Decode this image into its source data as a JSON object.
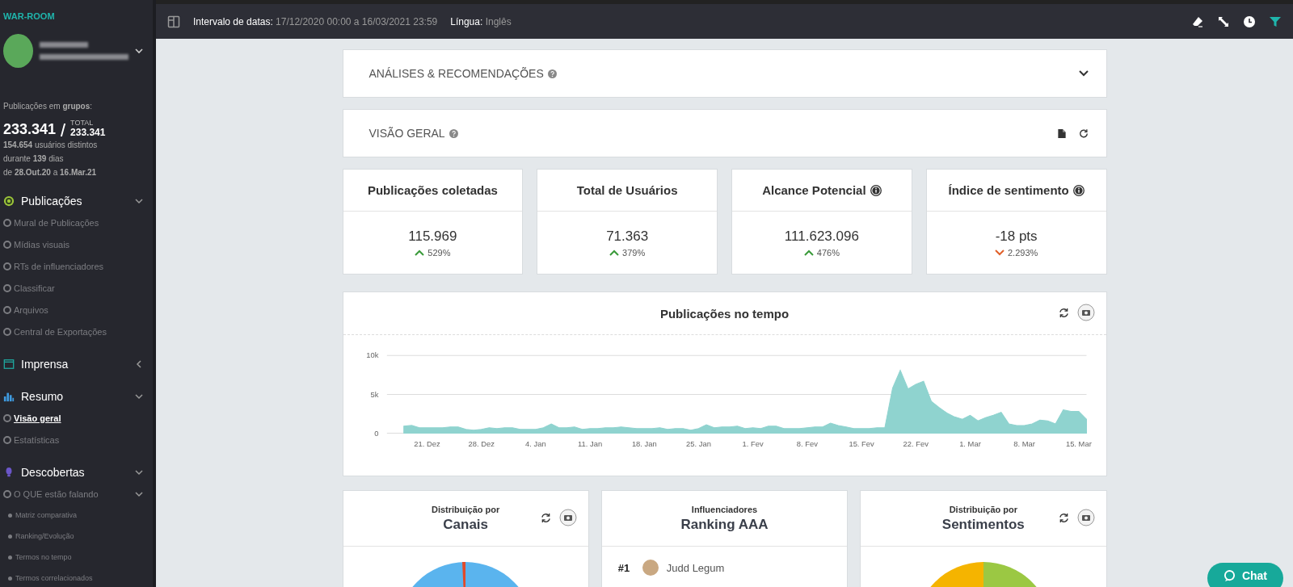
{
  "sidebar": {
    "brand": "WAR-ROOM",
    "stats": {
      "heading": "Publicações em **grupos**:",
      "count": "233.341",
      "total_label": "TOTAL",
      "total": "233.341",
      "lines": [
        "**154.654** usuários distintos",
        "durante **139** dias",
        "de **28.Out.20** a **16.Mar.21**"
      ]
    },
    "sections": [
      {
        "label": "Publicações",
        "kind": "target",
        "expanded": true,
        "items": [
          {
            "label": "Mural de Publicações",
            "selected": false
          },
          {
            "label": "Mídias visuais",
            "selected": false
          },
          {
            "label": "RTs de influenciadores",
            "selected": false
          },
          {
            "label": "Classificar",
            "selected": false
          },
          {
            "label": "Arquivos",
            "selected": false
          },
          {
            "label": "Central de Exportações",
            "selected": false
          }
        ]
      },
      {
        "label": "Imprensa",
        "kind": "newspaper",
        "expanded": false
      },
      {
        "label": "Resumo",
        "kind": "bars",
        "expanded": true,
        "items": [
          {
            "label": "Visão geral",
            "selected": true
          },
          {
            "label": "Estatísticas",
            "selected": false
          }
        ]
      },
      {
        "label": "Descobertas",
        "kind": "bulb",
        "expanded": true,
        "items": [
          {
            "label": "O QUE estão falando",
            "selected": false,
            "expanded": true,
            "children": [
              {
                "label": "Matriz comparativa"
              },
              {
                "label": "Ranking/Evolução"
              },
              {
                "label": "Termos no tempo"
              },
              {
                "label": "Termos correlacionados"
              }
            ]
          }
        ]
      }
    ]
  },
  "topbar": {
    "filters": [
      {
        "label": "Intervalo de datas:",
        "value": "17/12/2020 00:00 a 16/03/2021 23:59"
      },
      {
        "label": "Língua:",
        "value": "Inglês"
      }
    ],
    "filter_active": true
  },
  "panels": [
    {
      "kind": "collapsible",
      "title": "ANÁLISES & RECOMENDAÇÕES",
      "help": true
    },
    {
      "kind": "toolbar",
      "title": "VISÃO GERAL",
      "help": true
    }
  ],
  "kpis": [
    {
      "title": "Publicações coletadas",
      "info": false,
      "value": "115.969",
      "change": "529%",
      "up": true
    },
    {
      "title": "Total de Usuários",
      "info": false,
      "value": "71.363",
      "change": "379%",
      "up": true
    },
    {
      "title": "Alcance Potencial",
      "info": true,
      "value": "111.623.096",
      "change": "476%",
      "up": true
    },
    {
      "title": "Índice de sentimento",
      "info": true,
      "value": "-18 pts",
      "change": "2.293%",
      "up": false
    }
  ],
  "timeline": {
    "title": "Publicações no tempo",
    "chart_data": {
      "type": "area",
      "categories": [
        null,
        null,
        null,
        "21. Dez",
        null,
        null,
        null,
        null,
        null,
        null,
        "28. Dez",
        null,
        null,
        null,
        null,
        null,
        null,
        "4. Jan",
        null,
        null,
        null,
        null,
        null,
        null,
        "11. Jan",
        null,
        null,
        null,
        null,
        null,
        null,
        "18. Jan",
        null,
        null,
        null,
        null,
        null,
        null,
        "25. Jan",
        null,
        null,
        null,
        null,
        null,
        null,
        "1. Fev",
        null,
        null,
        null,
        null,
        null,
        null,
        "8. Fev",
        null,
        null,
        null,
        null,
        null,
        null,
        "15. Fev",
        null,
        null,
        null,
        null,
        null,
        null,
        "22. Fev",
        null,
        null,
        null,
        null,
        null,
        null,
        "1. Mar",
        null,
        null,
        null,
        null,
        null,
        null,
        "8. Mar",
        null,
        null,
        null,
        null,
        null,
        null,
        "15. Mar",
        null
      ],
      "series": [
        {
          "color": "#8fd3cf",
          "values": [
            900,
            1000,
            700,
            700,
            700,
            700,
            800,
            800,
            500,
            400,
            500,
            700,
            600,
            700,
            700,
            500,
            500,
            500,
            700,
            1200,
            700,
            700,
            800,
            500,
            600,
            600,
            700,
            700,
            800,
            700,
            600,
            600,
            600,
            700,
            500,
            600,
            600,
            400,
            600,
            1100,
            700,
            800,
            800,
            900,
            600,
            700,
            600,
            900,
            900,
            600,
            600,
            600,
            700,
            800,
            800,
            1300,
            1000,
            800,
            600,
            600,
            600,
            700,
            700,
            5800,
            8100,
            5700,
            6300,
            6700,
            4100,
            3300,
            2600,
            2100,
            1800,
            2300,
            1600,
            2000,
            2300,
            2700,
            1200,
            1000,
            1000,
            1200,
            1700,
            1600,
            1200,
            3000,
            2800,
            2800,
            1800
          ]
        }
      ],
      "yticks": [
        0,
        {
          "value": 5000,
          "label": "5k"
        },
        {
          "value": 10000,
          "label": "10k"
        }
      ],
      "ylim": [
        0,
        10000
      ]
    }
  },
  "cards": [
    {
      "kind": "pie-channels",
      "subtitle": "Distribuição por",
      "title": "Canais",
      "tools": true
    },
    {
      "kind": "ranking",
      "subtitle": "Influenciadores",
      "title": "Ranking AAA",
      "tools": false,
      "rows": [
        {
          "rank": "#1",
          "name": "Judd Legum"
        }
      ]
    },
    {
      "kind": "pie-sentiment",
      "subtitle": "Distribuição por",
      "title": "Sentimentos",
      "tools": true
    }
  ],
  "chat": {
    "label": "Chat"
  }
}
